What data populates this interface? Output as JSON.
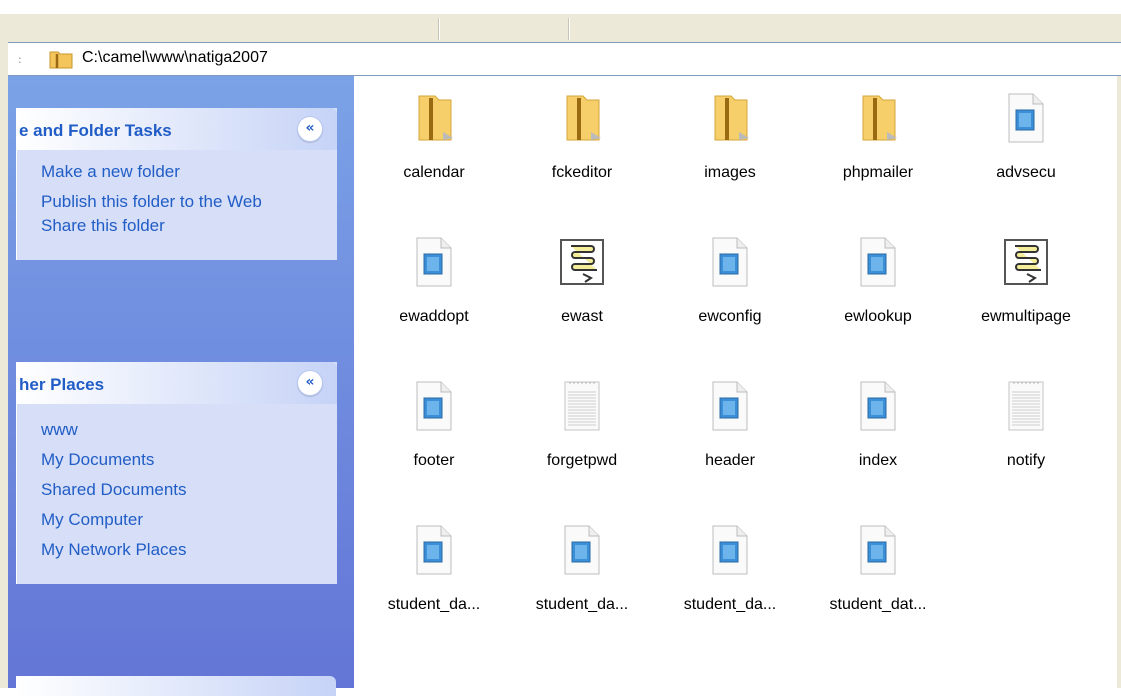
{
  "address": {
    "path": "C:\\camel\\www\\natiga2007"
  },
  "task_panels": [
    {
      "title": "e and Folder Tasks",
      "collapse_symbol": "«",
      "links": [
        "Make a new folder",
        "Publish this folder to the Web",
        "Share this folder"
      ]
    },
    {
      "title": "her Places",
      "collapse_symbol": "«",
      "links": [
        "www",
        "My Documents",
        "Shared Documents",
        "My Computer",
        "My Network Places"
      ]
    }
  ],
  "files": [
    {
      "name": "calendar",
      "icon": "folder-icon"
    },
    {
      "name": "fckeditor",
      "icon": "folder-icon"
    },
    {
      "name": "images",
      "icon": "folder-icon"
    },
    {
      "name": "phpmailer",
      "icon": "folder-icon"
    },
    {
      "name": "advsecu",
      "icon": "php-file-icon"
    },
    {
      "name": "ewaddopt",
      "icon": "php-file-icon"
    },
    {
      "name": "ewast",
      "icon": "script-file-icon"
    },
    {
      "name": "ewconfig",
      "icon": "php-file-icon"
    },
    {
      "name": "ewlookup",
      "icon": "php-file-icon"
    },
    {
      "name": "ewmultipage",
      "icon": "script-file-icon"
    },
    {
      "name": "footer",
      "icon": "php-file-icon"
    },
    {
      "name": "forgetpwd",
      "icon": "text-file-icon"
    },
    {
      "name": "header",
      "icon": "php-file-icon"
    },
    {
      "name": "index",
      "icon": "php-file-icon"
    },
    {
      "name": "notify",
      "icon": "text-file-icon"
    },
    {
      "name": "student_da...",
      "icon": "php-file-icon"
    },
    {
      "name": "student_da...",
      "icon": "php-file-icon"
    },
    {
      "name": "student_da...",
      "icon": "php-file-icon"
    },
    {
      "name": "student_dat...",
      "icon": "php-file-icon"
    }
  ],
  "colors": {
    "task_pane_bg": "#7ba2e7",
    "panel_bg": "#d6dff7",
    "link": "#215dc6",
    "folder": "#f3c55b"
  }
}
